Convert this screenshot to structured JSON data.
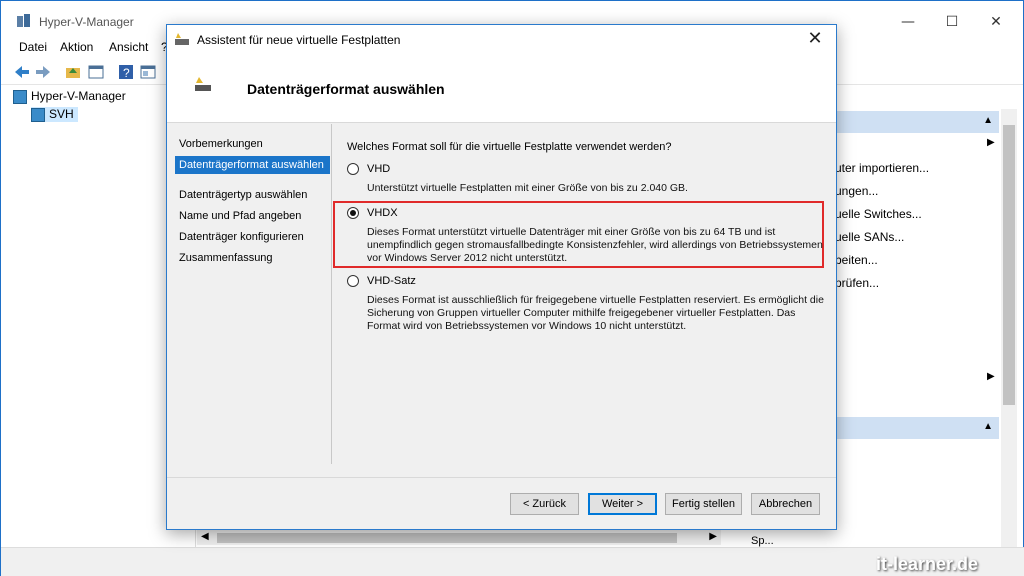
{
  "main_window": {
    "title": "Hyper-V-Manager",
    "controls": {
      "minimize": "—",
      "maximize": "☐",
      "close": "✕"
    },
    "menu": [
      "Datei",
      "Aktion",
      "Ansicht",
      "?"
    ],
    "tree": [
      "Hyper-V-Manager",
      "SVH"
    ],
    "actions": [
      "uter importieren...",
      "ungen...",
      "uelle Switches...",
      "uelle SANs...",
      "beiten...",
      "prüfen..."
    ],
    "bottom_cut": "Sp..."
  },
  "watermark": "it-learner.de",
  "dialog": {
    "title": "Assistent für neue virtuelle Festplatten",
    "close": "✕",
    "header": "Datenträgerformat auswählen",
    "steps": [
      "Vorbemerkungen",
      "Datenträgerformat auswählen",
      "Datenträgertyp auswählen",
      "Name und Pfad angeben",
      "Datenträger konfigurieren",
      "Zusammenfassung"
    ],
    "active_step": 1,
    "question": "Welches Format soll für die virtuelle Festplatte verwendet werden?",
    "options": [
      {
        "label": "VHD",
        "checked": false,
        "description": "Unterstützt virtuelle Festplatten mit einer Größe von bis zu 2.040 GB."
      },
      {
        "label": "VHDX",
        "checked": true,
        "description": "Dieses Format unterstützt virtuelle Datenträger mit einer Größe von bis zu 64 TB und ist unempfindlich gegen stromausfallbedingte Konsistenzfehler, wird allerdings von Betriebssystemen vor Windows Server 2012 nicht unterstützt."
      },
      {
        "label": "VHD-Satz",
        "checked": false,
        "description": "Dieses Format ist ausschließlich für freigegebene virtuelle Festplatten reserviert. Es ermöglicht die Sicherung von Gruppen virtueller Computer mithilfe freigegebener virtueller Festplatten. Das Format wird von Betriebssystemen vor Windows 10 nicht unterstützt."
      }
    ],
    "buttons": {
      "back": "< Zurück",
      "next": "Weiter >",
      "finish": "Fertig stellen",
      "cancel": "Abbrechen"
    }
  }
}
